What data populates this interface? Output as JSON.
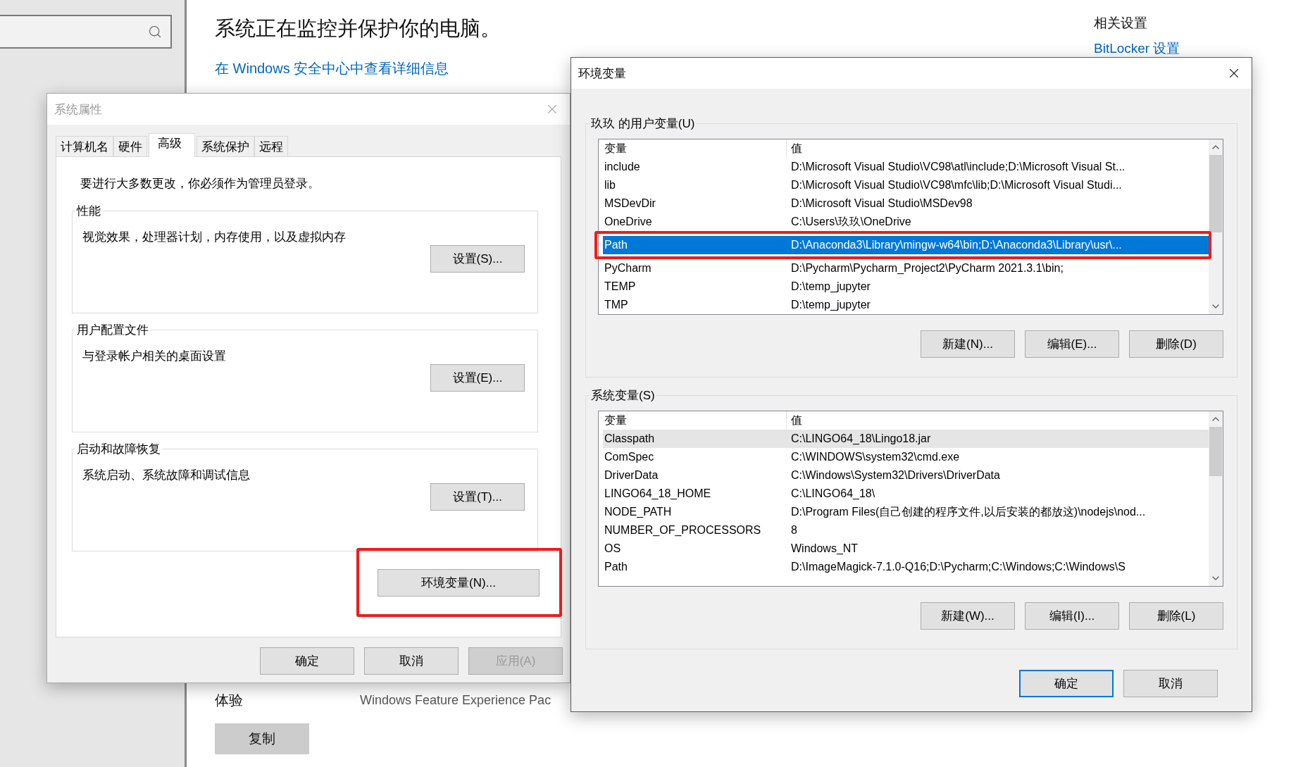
{
  "settings_page": {
    "heading": "系统正在监控并保护你的电脑。",
    "security_link": "在 Windows 安全中心中查看详细信息",
    "related_title": "相关设置",
    "related_link": "BitLocker 设置",
    "experience_label": "体验",
    "experience_value": "Windows Feature Experience Pac",
    "copy_button": "复制"
  },
  "system_properties": {
    "title": "系统属性",
    "active": false,
    "tabs": [
      {
        "label": "计算机名",
        "selected": false
      },
      {
        "label": "硬件",
        "selected": false
      },
      {
        "label": "高级",
        "selected": true
      },
      {
        "label": "系统保护",
        "selected": false
      },
      {
        "label": "远程",
        "selected": false
      }
    ],
    "admin_note": "要进行大多数更改，你必须作为管理员登录。",
    "groups": [
      {
        "title": "性能",
        "description": "视觉效果，处理器计划，内存使用，以及虚拟内存",
        "button": "设置(S)..."
      },
      {
        "title": "用户配置文件",
        "description": "与登录帐户相关的桌面设置",
        "button": "设置(E)..."
      },
      {
        "title": "启动和故障恢复",
        "description": "系统启动、系统故障和调试信息",
        "button": "设置(T)..."
      }
    ],
    "env_button": {
      "label": "环境变量(N)...",
      "highlighted": true
    },
    "buttons": [
      {
        "label": "确定",
        "disabled": false
      },
      {
        "label": "取消",
        "disabled": false
      },
      {
        "label": "应用(A)",
        "disabled": true
      }
    ]
  },
  "environment_variables": {
    "title": "环境变量",
    "active": true,
    "sections": [
      {
        "title": "玖玖 的用户变量(U)",
        "focused": true,
        "columns": [
          "变量",
          "值"
        ],
        "rows": [
          {
            "name": "include",
            "value": "D:\\Microsoft Visual Studio\\VC98\\atl\\include;D:\\Microsoft Visual St...",
            "selected": false,
            "highlighted": false
          },
          {
            "name": "lib",
            "value": "D:\\Microsoft Visual Studio\\VC98\\mfc\\lib;D:\\Microsoft Visual Studi...",
            "selected": false,
            "highlighted": false
          },
          {
            "name": "MSDevDir",
            "value": "D:\\Microsoft Visual Studio\\MSDev98",
            "selected": false,
            "highlighted": false
          },
          {
            "name": "OneDrive",
            "value": "C:\\Users\\玖玖\\OneDrive",
            "selected": false,
            "highlighted": false
          },
          {
            "name": "Path",
            "value": "D:\\Anaconda3\\Library\\mingw-w64\\bin;D:\\Anaconda3\\Library\\usr\\...",
            "selected": true,
            "highlighted": true
          },
          {
            "name": "PyCharm",
            "value": "D:\\Pycharm\\Pycharm_Project2\\PyCharm 2021.3.1\\bin;",
            "selected": false,
            "highlighted": false
          },
          {
            "name": "TEMP",
            "value": "D:\\temp_jupyter",
            "selected": false,
            "highlighted": false
          },
          {
            "name": "TMP",
            "value": "D:\\temp_jupyter",
            "selected": false,
            "highlighted": false
          }
        ],
        "buttons": [
          "新建(N)...",
          "编辑(E)...",
          "删除(D)"
        ]
      },
      {
        "title": "系统变量(S)",
        "focused": false,
        "columns": [
          "变量",
          "值"
        ],
        "rows": [
          {
            "name": "Classpath",
            "value": "C:\\LINGO64_18\\Lingo18.jar",
            "selected": true,
            "highlighted": false
          },
          {
            "name": "ComSpec",
            "value": "C:\\WINDOWS\\system32\\cmd.exe",
            "selected": false,
            "highlighted": false
          },
          {
            "name": "DriverData",
            "value": "C:\\Windows\\System32\\Drivers\\DriverData",
            "selected": false,
            "highlighted": false
          },
          {
            "name": "LINGO64_18_HOME",
            "value": "C:\\LINGO64_18\\",
            "selected": false,
            "highlighted": false
          },
          {
            "name": "NODE_PATH",
            "value": "D:\\Program Files(自己创建的程序文件,以后安装的都放这)\\nodejs\\nod...",
            "selected": false,
            "highlighted": false
          },
          {
            "name": "NUMBER_OF_PROCESSORS",
            "value": "8",
            "selected": false,
            "highlighted": false
          },
          {
            "name": "OS",
            "value": "Windows_NT",
            "selected": false,
            "highlighted": false
          },
          {
            "name": "Path",
            "value": "D:\\ImageMagick-7.1.0-Q16;D:\\Pycharm;C:\\Windows;C:\\Windows\\S",
            "selected": false,
            "highlighted": false
          }
        ],
        "buttons": [
          "新建(W)...",
          "编辑(I)...",
          "删除(L)"
        ]
      }
    ],
    "buttons": [
      {
        "label": "确定",
        "default": true
      },
      {
        "label": "取消",
        "default": false
      }
    ]
  }
}
